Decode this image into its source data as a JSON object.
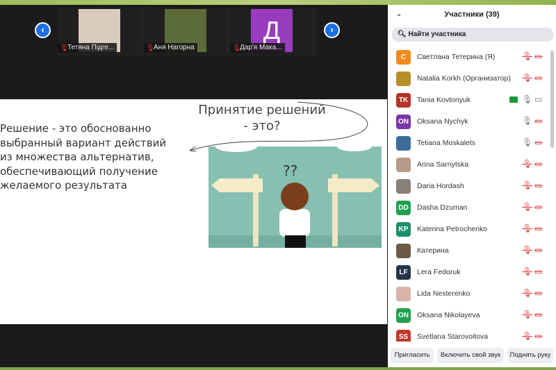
{
  "thumbnails": [
    {
      "name": "Тетяна Підге...",
      "initial": "",
      "color": "#d9cbbd"
    },
    {
      "name": "Аня Нагорна",
      "initial": "",
      "color": "#5b6b3a"
    },
    {
      "name": "Дар'я Мака...",
      "initial": "Д",
      "color": "#9a3cbf"
    }
  ],
  "slide": {
    "title": "Принятие решений\n- это?",
    "definition": "Решение - это обоснованно выбранный вариант действий из множества альтернатив, обеспечивающий получение желаемого результата",
    "question_marks": "??"
  },
  "panel": {
    "title": "Участники (39)",
    "search_placeholder": "Найти участника",
    "participants": [
      {
        "name": "Светлана Тетерина (Я)",
        "initials": "С",
        "color": "#f08a1c",
        "mic": "muted",
        "video": "off"
      },
      {
        "name": "Natalia Korkh (Организатор)",
        "initials": "",
        "color": "#b5902a",
        "mic": "muted",
        "video": "off"
      },
      {
        "name": "Tania Kovtonyuk",
        "initials": "TK",
        "color": "#b5332a",
        "mic": "on",
        "video": "on",
        "sharing": true
      },
      {
        "name": "Oksana Nychyk",
        "initials": "ON",
        "color": "#7b35a8",
        "mic": "on",
        "video": "off"
      },
      {
        "name": "Tetiana Moskalets",
        "initials": "",
        "color": "#3c6d9a",
        "mic": "on",
        "video": "off"
      },
      {
        "name": "Arina Sarnytska",
        "initials": "",
        "color": "#b89a8a",
        "mic": "muted",
        "video": "off"
      },
      {
        "name": "Daria Hordash",
        "initials": "",
        "color": "#8a8078",
        "mic": "muted",
        "video": "off"
      },
      {
        "name": "Dasha Dzuman",
        "initials": "DD",
        "color": "#22a050",
        "mic": "muted",
        "video": "off"
      },
      {
        "name": "Katerina Petrochenko",
        "initials": "KP",
        "color": "#1e8f6e",
        "mic": "muted",
        "video": "off"
      },
      {
        "name": "Катерина",
        "initials": "",
        "color": "#6b5a48",
        "mic": "muted",
        "video": "off"
      },
      {
        "name": "Lera Fedoruk",
        "initials": "LF",
        "color": "#26344a",
        "mic": "muted",
        "video": "off"
      },
      {
        "name": "Lida Nesterenko",
        "initials": "",
        "color": "#d8b4a8",
        "mic": "muted",
        "video": "off"
      },
      {
        "name": "Oksana Nikolayeva",
        "initials": "ON",
        "color": "#22a050",
        "mic": "muted",
        "video": "off"
      },
      {
        "name": "Svetlana Starovoitova",
        "initials": "SS",
        "color": "#c0392b",
        "mic": "muted",
        "video": "off"
      }
    ],
    "buttons": {
      "invite": "Пригласить",
      "unmute": "Включить свой звук",
      "raise_hand": "Поднять руку"
    }
  }
}
